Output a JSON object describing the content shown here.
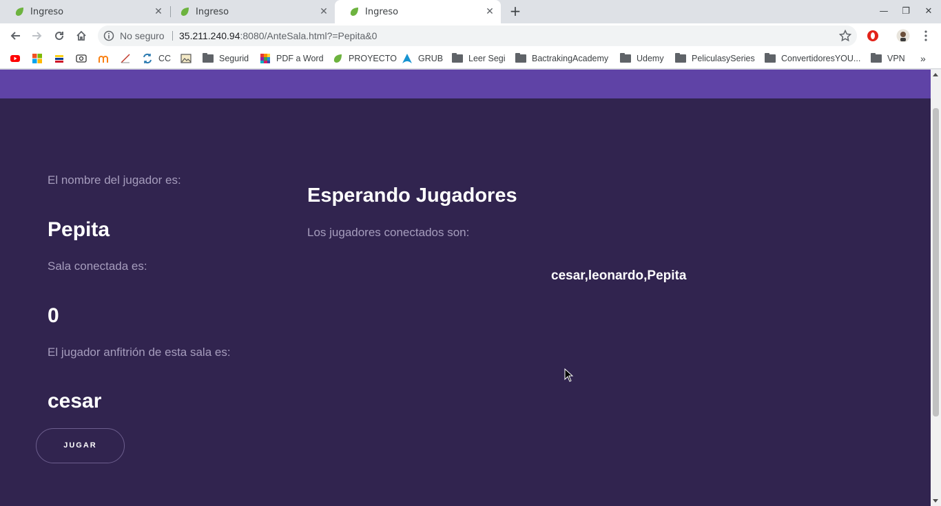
{
  "browser": {
    "tabs": [
      {
        "title": "Ingreso",
        "active": false
      },
      {
        "title": "Ingreso",
        "active": false
      },
      {
        "title": "Ingreso",
        "active": true
      }
    ],
    "address": {
      "security_label": "No seguro",
      "host": "35.211.240.94",
      "path": ":8080/AnteSala.html?=Pepita&0"
    },
    "bookmarks": [
      {
        "label": "",
        "icon": "youtube-icon"
      },
      {
        "label": "",
        "icon": "microsoft-icon"
      },
      {
        "label": "",
        "icon": "bank-icon"
      },
      {
        "label": "",
        "icon": "cd-icon"
      },
      {
        "label": "",
        "icon": "moodle-icon"
      },
      {
        "label": "",
        "icon": "chart-icon"
      },
      {
        "label": "CC",
        "icon": "sync-icon"
      },
      {
        "label": "",
        "icon": "image-icon"
      },
      {
        "label": "Segurid",
        "icon": "folder-icon"
      },
      {
        "label": "PDF a Word",
        "icon": "colorful-grid-icon"
      },
      {
        "label": "PROYECTO",
        "icon": "leaf-icon"
      },
      {
        "label": "GRUB",
        "icon": "arch-icon"
      },
      {
        "label": "Leer Segi",
        "icon": "folder-icon"
      },
      {
        "label": "BactrakingAcademy",
        "icon": "folder-icon"
      },
      {
        "label": "Udemy",
        "icon": "folder-icon"
      },
      {
        "label": "PeliculasySeries",
        "icon": "folder-icon"
      },
      {
        "label": "ConvertidoresYOU...",
        "icon": "folder-icon"
      },
      {
        "label": "VPN",
        "icon": "folder-icon"
      }
    ]
  },
  "page": {
    "player_label": "El nombre del jugador es:",
    "player_name": "Pepita",
    "room_label": "Sala conectada es:",
    "room_id": "0",
    "host_label": "El jugador anfitrión de esta sala es:",
    "host_name": "cesar",
    "play_button": "JUGAR",
    "waiting_title": "Esperando Jugadores",
    "connected_label": "Los jugadores conectados son:",
    "connected_players": "cesar,leonardo,Pepita"
  },
  "colors": {
    "band": "#5f43a6",
    "background": "#31244f"
  }
}
